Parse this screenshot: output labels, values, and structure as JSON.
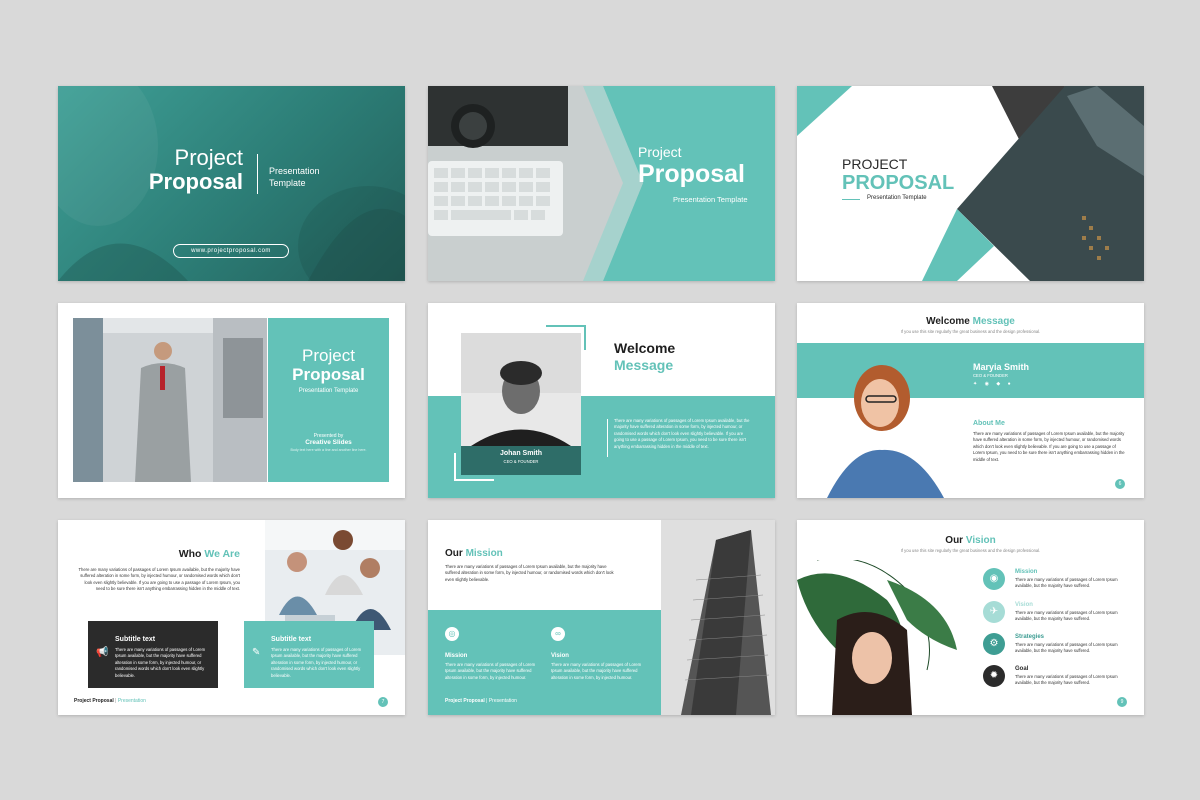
{
  "accent": "#63c2b8",
  "dark": "#2b2b2b",
  "s1": {
    "title_light": "Project",
    "title_bold": "Proposal",
    "subtitle_1": "Presentation",
    "subtitle_2": "Template",
    "url": "www.projectproposal.com"
  },
  "s2": {
    "title_light": "Project",
    "title_bold": "Proposal",
    "subtitle": "Presentation Template"
  },
  "s3": {
    "title_1": "PROJECT",
    "title_2": "PROPOSAL",
    "subtitle": "Presentation Template"
  },
  "s4": {
    "title_light": "Project",
    "title_bold": "Proposal",
    "subtitle": "Presentation Template",
    "presented_by": "Presented by",
    "presenter": "Creative Slides",
    "body": "Body text here with a line and another line here."
  },
  "s5": {
    "title_1": "Welcome",
    "title_2": "Message",
    "name": "Johan Smith",
    "role": "CEO & FOUNDER",
    "body": "There are many variations of passages of Lorem Ipsum available, but the majority have suffered alteration in some form, by injected humour, or randomised words which don't look even slightly believable. If you are going to use a passage of Lorem Ipsum, you need to be sure there isn't anything embarrassing hidden in the middle of text."
  },
  "s6": {
    "title_1": "Welcome",
    "title_2": "Message",
    "intro": "If you use this site regularly the great business and the design professional.",
    "name": "Maryia Smith",
    "role": "CEO & FOUNDER",
    "about_title": "About Me",
    "body": "There are many variations of passages of Lorem Ipsum available, but the majority have suffered alteration in some form, by injected humour, or randomised words which don't look even slightly believable. If you are going to use a passage of Lorem Ipsum, you need to be sure there isn't anything embarrassing hidden in the middle of text.",
    "page": "6"
  },
  "s7": {
    "title_1": "Who",
    "title_2": "We Are",
    "body": "There are many variations of passages of Lorem Ipsum available, but the majority have suffered alteration in some form, by injected humour, or randomised words which don't look even slightly believable. If you are going to use a passage of Lorem Ipsum, you need to be sure there isn't anything embarrassing hidden in the middle of text.",
    "box1_title": "Subtitle text",
    "box1_body": "There are many variations of passages of Lorem Ipsum available, but the majority have suffered alteration in some form, by injected humour, or randomised words which don't look even slightly believable.",
    "box2_title": "Subtitle text",
    "box2_body": "There are many variations of passages of Lorem Ipsum available, but the majority have suffered alteration in some form, by injected humour, or randomised words which don't look even slightly believable.",
    "footer_bold": "Project Proposal",
    "footer_light": "Presentation",
    "page": "7"
  },
  "s8": {
    "title_1": "Our",
    "title_2": "Mission",
    "body": "There are many variations of passages of Lorem Ipsum available, but the majority have suffered alteration in some form, by injected humour, or randomised words which don't look even slightly believable.",
    "mission_title": "Mission",
    "mission_body": "There are many variations of passages of Lorem Ipsum available, but the majority have suffered alteration in some form, by injected humour.",
    "vision_title": "Vision",
    "vision_body": "There are many variations of passages of Lorem Ipsum available, but the majority have suffered alteration in some form, by injected humour.",
    "footer_bold": "Project Proposal",
    "footer_light": "Presentation"
  },
  "s9": {
    "title_1": "Our",
    "title_2": "Vision",
    "intro": "If you use this site regularly the great business and the design professional.",
    "items": [
      {
        "title": "Mission",
        "body": "There are many variations of passages of Lorem Ipsum available, but the majority have suffered."
      },
      {
        "title": "Vision",
        "body": "There are many variations of passages of Lorem Ipsum available, but the majority have suffered."
      },
      {
        "title": "Strategies",
        "body": "There are many variations of passages of Lorem Ipsum available, but the majority have suffered."
      },
      {
        "title": "Goal",
        "body": "There are many variations of passages of Lorem Ipsum available, but the majority have suffered."
      }
    ],
    "page": "9"
  }
}
